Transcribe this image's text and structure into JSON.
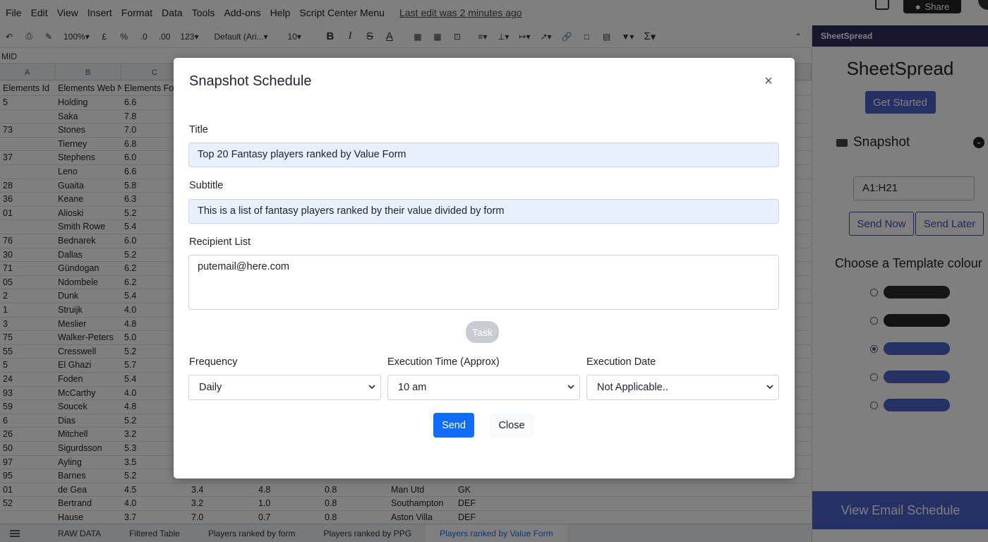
{
  "menubar": {
    "items": [
      "File",
      "Edit",
      "View",
      "Insert",
      "Format",
      "Data",
      "Tools",
      "Add-ons",
      "Help",
      "Script Center Menu"
    ],
    "last_edit": "Last edit was 2 minutes ago",
    "share_label": "Share"
  },
  "toolbar": {
    "zoom": "100%",
    "currency": "£",
    "percent": "%",
    "dec_less": ".0",
    "dec_more": ".00",
    "format_more": "123",
    "font": "Default (Ari...",
    "font_size": "10",
    "bold": "B",
    "italic": "I",
    "strike": "S",
    "text_color": "A",
    "sigma": "Σ"
  },
  "namebox": "MID",
  "grid": {
    "col_letters": [
      "A",
      "B",
      "C"
    ],
    "headers": [
      "Elements Id",
      "Elements Web N",
      "Elements Fo"
    ],
    "rows": [
      [
        "5",
        "Holding",
        "6.6"
      ],
      [
        "",
        "Saka",
        "7.8"
      ],
      [
        "73",
        "Stones",
        "7.0"
      ],
      [
        "",
        "Tierney",
        "6.8"
      ],
      [
        "37",
        "Stephens",
        "6.0"
      ],
      [
        "",
        "Leno",
        "6.6"
      ],
      [
        "28",
        "Guaita",
        "5.8"
      ],
      [
        "36",
        "Keane",
        "6.3"
      ],
      [
        "01",
        "Alioski",
        "5.2"
      ],
      [
        "",
        "Smith Rowe",
        "5.4"
      ],
      [
        "76",
        "Bednarek",
        "6.0"
      ],
      [
        "30",
        "Dallas",
        "5.2"
      ],
      [
        "71",
        "Gündogan",
        "6.2"
      ],
      [
        "05",
        "Ndombele",
        "6.2"
      ],
      [
        "2",
        "Dunk",
        "5.4"
      ],
      [
        "1",
        "Struijk",
        "4.0"
      ],
      [
        "3",
        "Meslier",
        "4.8"
      ],
      [
        "75",
        "Walker-Peters",
        "5.0"
      ],
      [
        "55",
        "Cresswell",
        "5.2"
      ],
      [
        "5",
        "El Ghazi",
        "5.7"
      ],
      [
        "24",
        "Foden",
        "5.4"
      ],
      [
        "93",
        "McCarthy",
        "4.0"
      ],
      [
        "59",
        "Soucek",
        "4.8"
      ],
      [
        "6",
        "Dias",
        "5.2"
      ],
      [
        "26",
        "Mitchell",
        "3.2"
      ],
      [
        "50",
        "Sigurdsson",
        "5.3"
      ],
      [
        "97",
        "Ayling",
        "3.5"
      ],
      [
        "95",
        "Barnes",
        "5.2"
      ],
      [
        "01",
        "de Gea",
        "4.5",
        "3.4",
        "4.8",
        "0.8",
        "Man Utd",
        "GK"
      ],
      [
        "52",
        "Bertrand",
        "4.0",
        "3.2",
        "1.0",
        "0.8",
        "Southampton",
        "DEF"
      ],
      [
        "",
        "Hause",
        "3.7",
        "7.0",
        "0.7",
        "0.8",
        "Aston Villa",
        "DEF"
      ]
    ]
  },
  "sheet_tabs": [
    "RAW DATA",
    "Filtered Table",
    "Players ranked by form",
    "Players ranked by PPG",
    "Players ranked by Value Form"
  ],
  "sidebar": {
    "header": "SheetSpread",
    "title": "SheetSpread",
    "get_started": "Get Started",
    "snapshot_label": "Snapshot",
    "range": "A1:H21",
    "send_now": "Send Now",
    "send_later": "Send Later",
    "choose_label": "Choose a Template colour",
    "swatches": [
      {
        "color": "#2a2a2a",
        "selected": false
      },
      {
        "color": "#262626",
        "selected": false
      },
      {
        "color": "#4a63c9",
        "selected": true
      },
      {
        "color": "#4a63c9",
        "selected": false
      },
      {
        "color": "#4a63c9",
        "selected": false
      }
    ],
    "view_schedule": "View Email Schedule"
  },
  "modal": {
    "title": "Snapshot Schedule",
    "title_label": "Title",
    "title_value": "Top 20 Fantasy players ranked by Value Form",
    "subtitle_label": "Subtitle",
    "subtitle_value": "This is a list of fantasy players ranked by their value divided by form",
    "recipient_label": "Recipient List",
    "recipient_value": "putemail@here.com",
    "task_label": "Task",
    "frequency_label": "Frequency",
    "frequency_value": "Daily",
    "exec_time_label": "Execution Time (Approx)",
    "exec_time_value": "10 am",
    "exec_date_label": "Execution Date",
    "exec_date_value": "Not Applicable..",
    "send_label": "Send",
    "close_label": "Close"
  }
}
